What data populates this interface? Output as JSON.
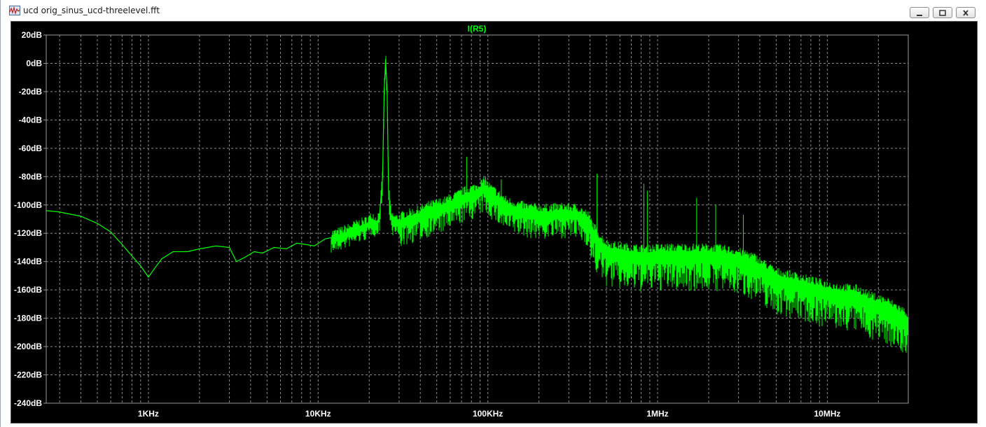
{
  "window": {
    "title": "ucd orig_sinus_ucd-threelevel.fft"
  },
  "colors": {
    "plot_background": "#000000",
    "trace": "#00ff00",
    "grid": "#8c8c8c",
    "tick_text": "#ffffff"
  },
  "chart_data": {
    "type": "line",
    "title": "I(R5)",
    "xscale": "log",
    "xlim": [
      250,
      30000000
    ],
    "ylim": [
      -240,
      20
    ],
    "grid": true,
    "x_ticks": [
      {
        "value": 1000,
        "label": "1KHz"
      },
      {
        "value": 10000,
        "label": "10KHz"
      },
      {
        "value": 100000,
        "label": "100KHz"
      },
      {
        "value": 1000000,
        "label": "1MHz"
      },
      {
        "value": 10000000,
        "label": "10MHz"
      }
    ],
    "y_ticks": [
      {
        "value": 20,
        "label": "20dB"
      },
      {
        "value": 0,
        "label": "0dB"
      },
      {
        "value": -20,
        "label": "-20dB"
      },
      {
        "value": -40,
        "label": "-40dB"
      },
      {
        "value": -60,
        "label": "-60dB"
      },
      {
        "value": -80,
        "label": "-80dB"
      },
      {
        "value": -100,
        "label": "-100dB"
      },
      {
        "value": -120,
        "label": "-120dB"
      },
      {
        "value": -140,
        "label": "-140dB"
      },
      {
        "value": -160,
        "label": "-160dB"
      },
      {
        "value": -180,
        "label": "-180dB"
      },
      {
        "value": -200,
        "label": "-200dB"
      },
      {
        "value": -220,
        "label": "-220dB"
      },
      {
        "value": -240,
        "label": "-240dB"
      }
    ],
    "series": [
      {
        "color": "#00ff00",
        "x": [
          250,
          300,
          400,
          500,
          600,
          700,
          800,
          900,
          1000,
          1100,
          1200,
          1400,
          1700,
          2000,
          2500,
          3000,
          3300,
          3700,
          4200,
          4700,
          5500,
          6500,
          7500,
          8500,
          9500,
          11000,
          13000,
          15000,
          17000,
          19000,
          21000,
          22000,
          23000,
          24000,
          24500,
          25000,
          25500,
          26000,
          27000,
          29000,
          33000,
          38000,
          45000,
          55000,
          65000,
          75000,
          85000,
          95000,
          105000,
          130000,
          170000,
          220000,
          280000,
          340000,
          390000,
          420000,
          460000,
          500000,
          600000,
          700000,
          850000,
          1000000,
          1200000,
          1500000,
          2000000,
          2500000,
          3000000,
          3500000,
          4000000,
          5000000,
          6000000,
          7000000,
          8000000,
          10000000,
          12000000,
          15000000,
          18000000,
          22000000,
          26000000,
          30000000
        ],
        "y": [
          -104,
          -105,
          -108,
          -113,
          -119,
          -128,
          -136,
          -143,
          -151,
          -144,
          -138,
          -133,
          -133,
          -131,
          -129,
          -130,
          -140,
          -137,
          -133,
          -134,
          -130,
          -131,
          -127,
          -128,
          -129,
          -124,
          -122,
          -119,
          -116,
          -114,
          -110,
          -113,
          -108,
          -80,
          -20,
          3,
          -20,
          -90,
          -110,
          -112,
          -109,
          -107,
          -103,
          -100,
          -96,
          -92,
          -90,
          -86,
          -91,
          -100,
          -104,
          -105,
          -104,
          -105,
          -110,
          -118,
          -125,
          -130,
          -132,
          -133,
          -134,
          -133,
          -133,
          -133,
          -133,
          -134,
          -136,
          -138,
          -142,
          -150,
          -152,
          -154,
          -156,
          -159,
          -161,
          -162,
          -167,
          -170,
          -175,
          -180
        ]
      }
    ]
  }
}
